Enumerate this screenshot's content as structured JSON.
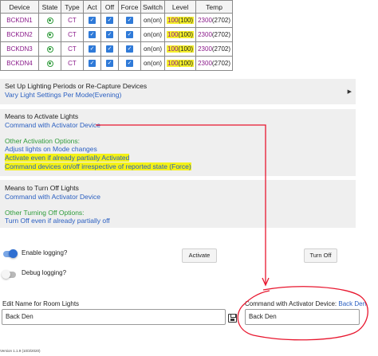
{
  "table": {
    "headers": [
      "Device",
      "State",
      "Type",
      "Act",
      "Off",
      "Force",
      "Switch",
      "Level",
      "Temp"
    ],
    "rows": [
      {
        "device": "BCKDN1",
        "type": "CT",
        "switch_on": "on",
        "switch_paren": "(on)",
        "level": "100",
        "level_paren": "(100)",
        "temp": "2300",
        "temp_paren": "(2702)"
      },
      {
        "device": "BCKDN2",
        "type": "CT",
        "switch_on": "on",
        "switch_paren": "(on)",
        "level": "100",
        "level_paren": "(100)",
        "temp": "2300",
        "temp_paren": "(2702)"
      },
      {
        "device": "BCKDN3",
        "type": "CT",
        "switch_on": "on",
        "switch_paren": "(on)",
        "level": "100",
        "level_paren": "(100)",
        "temp": "2300",
        "temp_paren": "(2702)"
      },
      {
        "device": "BCKDN4",
        "type": "CT",
        "switch_on": "on",
        "switch_paren": "(on)",
        "level": "100",
        "level_paren": "(100)",
        "temp": "2300",
        "temp_paren": "(2702)"
      }
    ]
  },
  "periods": {
    "title": "Set Up Lighting Periods or Re-Capture Devices",
    "subtitle": "Vary Light Settings Per Mode(Evening)"
  },
  "activate": {
    "title": "Means to Activate Lights",
    "value": "Command with Activator Device",
    "other_title": "Other Activation Options:",
    "opt1": "Adjust lights on Mode changes",
    "opt2": "Activate even if already partially Activated",
    "opt3": "Command devices on/off irrespective of reported state (Force)"
  },
  "turnoff": {
    "title": "Means to Turn Off Lights",
    "value": "Command with Activator Device",
    "other_title": "Other Turning Off Options:",
    "opt1": "Turn Off even if already partially off"
  },
  "controls": {
    "enable_logging": "Enable logging?",
    "debug_logging": "Debug logging?",
    "activate_btn": "Activate",
    "turnoff_btn": "Turn Off"
  },
  "fields": {
    "name_label": "Edit Name for Room Lights",
    "name_value": "Back Den",
    "activator_label": "Command with Activator Device:",
    "activator_link": "Back Den",
    "activator_value": "Back Den"
  },
  "version": "Version 1.1.9 (10/3/2020)",
  "colors": {
    "highlight": "#f5f217",
    "annotation": "#e8162e",
    "link": "#2a5fc1",
    "green": "#2e9b3a",
    "purple": "#8a1a8a"
  }
}
